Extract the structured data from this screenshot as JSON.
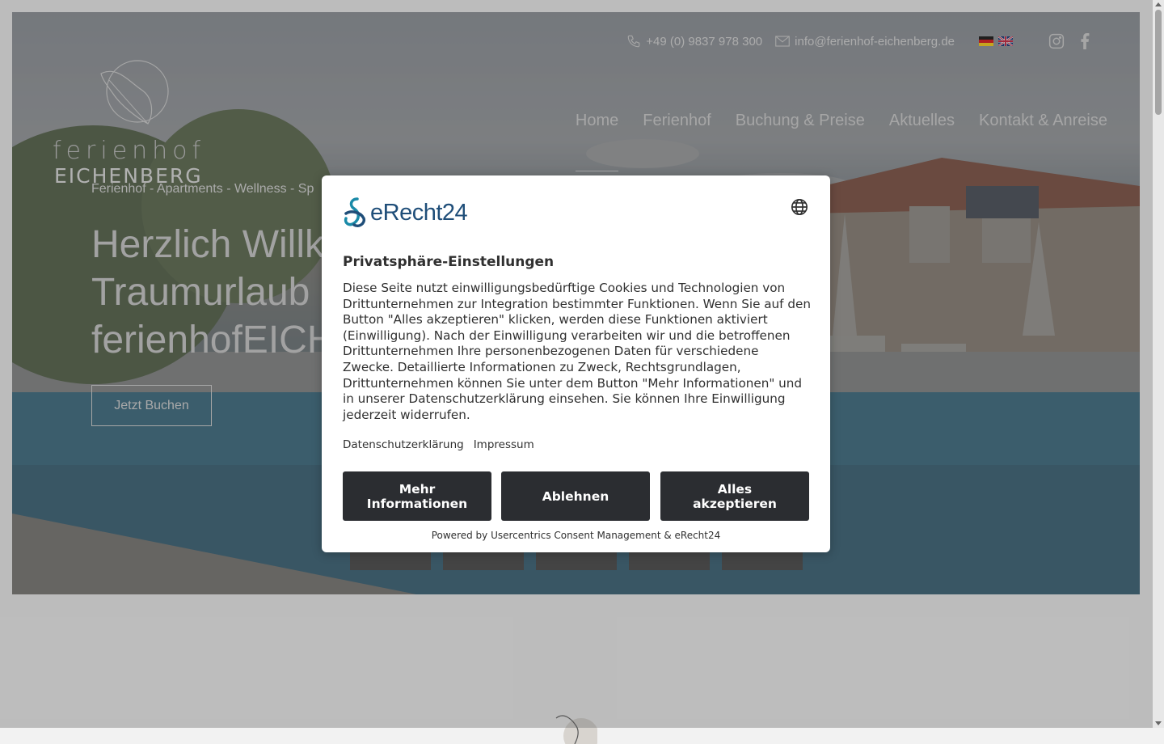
{
  "topbar": {
    "phone": "+49 (0) 9837 978 300",
    "email": "info@ferienhof-eichenberg.de",
    "languages": [
      "de-flag",
      "en-flag"
    ],
    "social": [
      "instagram-icon",
      "facebook-icon"
    ]
  },
  "logo": {
    "line1": "ferienhof",
    "line2": "EICHENBERG"
  },
  "tagline": "Ferienhof - Apartments - Wellness - Sp",
  "nav": {
    "items": [
      "Home",
      "Ferienhof",
      "Buchung & Preise",
      "Aktuelles",
      "Kontakt & Anreise"
    ],
    "active": "Home"
  },
  "hero": {
    "headline_line1": "Herzlich Willk",
    "headline_line2": "Traumurlaub",
    "headline_line3": "ferienhofEICH",
    "cta": "Jetzt Buchen"
  },
  "consent": {
    "brand": "eRecht24",
    "title": "Privatsphäre-Einstellungen",
    "description": "Diese Seite nutzt einwilligungsbedürftige Cookies und Technologien von Drittunternehmen zur Integration bestimmter Funktionen. Wenn Sie auf den Button \"Alles akzeptieren\" klicken, werden diese Funktionen aktiviert (Einwilligung). Nach der Einwilligung verarbeiten wir und die betroffenen Drittunternehmen Ihre personenbezogenen Daten für verschiedene Zwecke. Detaillierte Informationen zu Zweck, Rechtsgrundlagen, Drittunternehmen können Sie unter dem Button \"Mehr Informationen\" und in unserer Datenschutzerklärung einsehen. Sie können Ihre Einwilligung jederzeit widerrufen.",
    "link_privacy": "Datenschutzerklärung",
    "link_imprint": "Impressum",
    "btn_more_line1": "Mehr",
    "btn_more_line2": "Informationen",
    "btn_decline": "Ablehnen",
    "btn_accept_line1": "Alles",
    "btn_accept_line2": "akzeptieren",
    "footer": "Powered by Usercentrics Consent Management & eRecht24"
  },
  "colors": {
    "button_bg": "#2b2d31",
    "brand_blue": "#1f4e79",
    "brand_teal": "#1a8aa8"
  }
}
